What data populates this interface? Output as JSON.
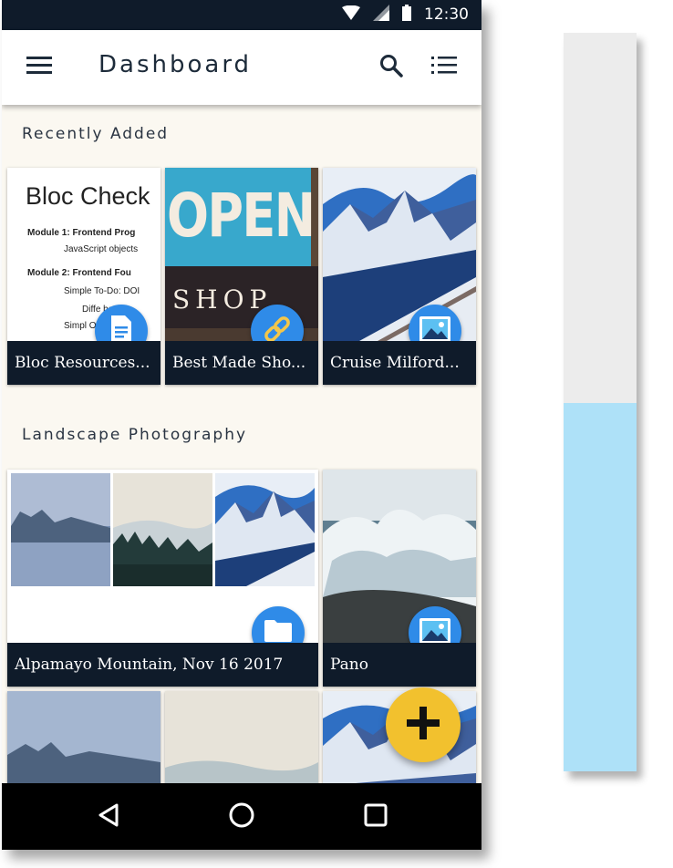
{
  "status_bar": {
    "time": "12:30"
  },
  "app_bar": {
    "title": "Dashboard"
  },
  "sections": {
    "recent": {
      "title": "Recently Added"
    },
    "landscape": {
      "title": "Landscape Photography"
    }
  },
  "recent_cards": [
    {
      "caption": "Bloc Resources...",
      "badge_icon": "document-icon"
    },
    {
      "caption": "Best Made Sho...",
      "badge_icon": "link-icon"
    },
    {
      "caption": "Cruise Milford...",
      "badge_icon": "image-icon"
    }
  ],
  "landscape_cards": [
    {
      "caption": "Alpamayo Mountain, Nov 16 2017",
      "badge_icon": "folder-icon"
    },
    {
      "caption": "Pano",
      "badge_icon": "image-icon"
    }
  ],
  "doc_preview": {
    "title": "Bloc Check",
    "lines": [
      "Module 1: Frontend Prog",
      "JavaScript objects",
      "Module 2: Frontend Fou",
      "Simple To-Do: DOI",
      "Diffe      betw",
      "Simpl          OI"
    ]
  },
  "sign_preview": {
    "top": "OPEN",
    "bottom": "SHOP"
  },
  "colors": {
    "accent": "#2f8be8",
    "fab": "#f2c12e",
    "caption_bg": "#0f1b2a",
    "panel_top": "#ececec",
    "panel_bottom": "#aee1f8"
  }
}
